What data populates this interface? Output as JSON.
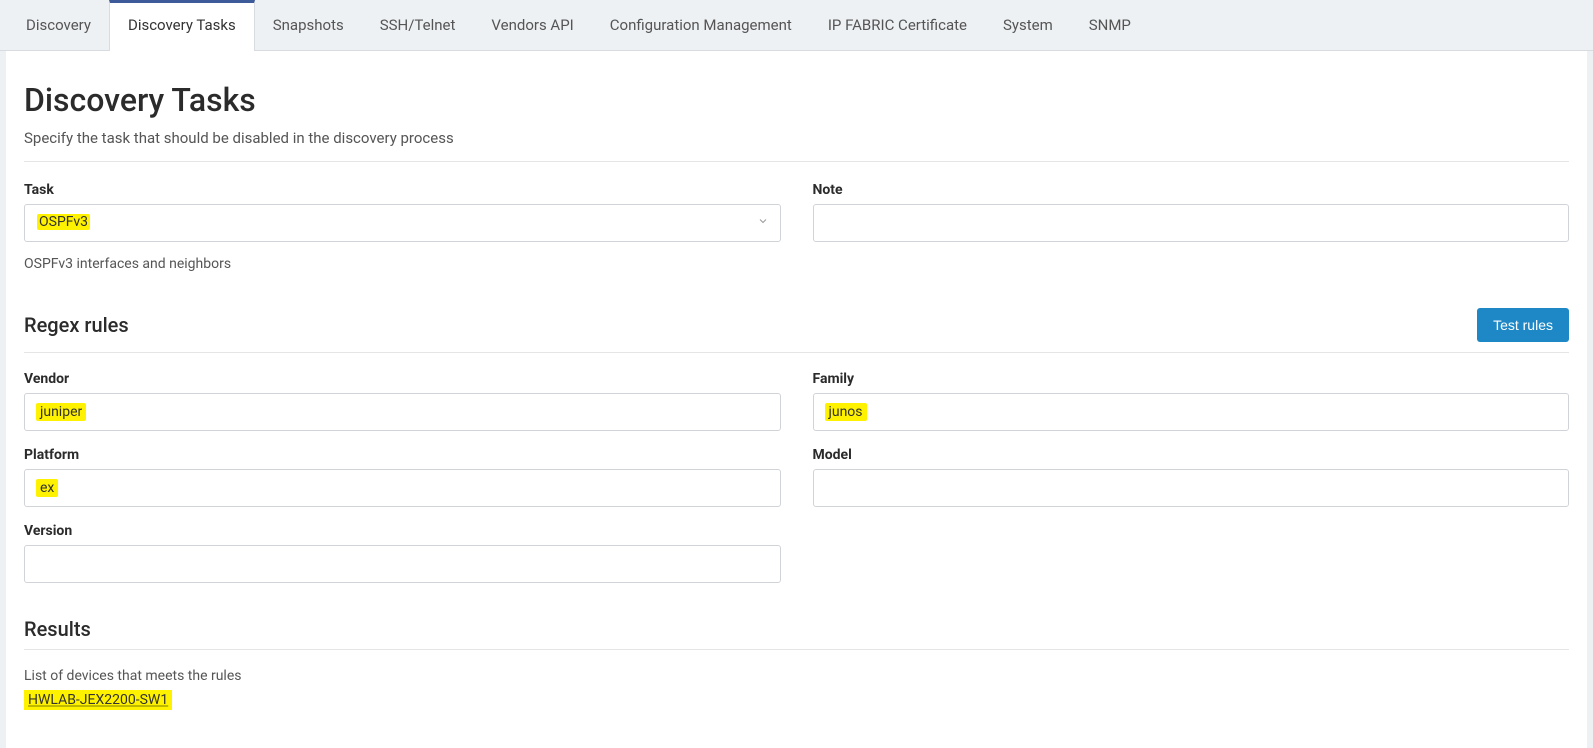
{
  "tabs": [
    {
      "label": "Discovery",
      "active": false
    },
    {
      "label": "Discovery Tasks",
      "active": true
    },
    {
      "label": "Snapshots",
      "active": false
    },
    {
      "label": "SSH/Telnet",
      "active": false
    },
    {
      "label": "Vendors API",
      "active": false
    },
    {
      "label": "Configuration Management",
      "active": false
    },
    {
      "label": "IP FABRIC Certificate",
      "active": false
    },
    {
      "label": "System",
      "active": false
    },
    {
      "label": "SNMP",
      "active": false
    }
  ],
  "page": {
    "title": "Discovery Tasks",
    "subtitle": "Specify the task that should be disabled in the discovery process"
  },
  "task_section": {
    "task_label": "Task",
    "task_value": "OSPFv3",
    "task_help": "OSPFv3 interfaces and neighbors",
    "note_label": "Note",
    "note_value": ""
  },
  "regex_section": {
    "title": "Regex rules",
    "test_button": "Test rules",
    "vendor_label": "Vendor",
    "vendor_value": "juniper",
    "family_label": "Family",
    "family_value": "junos",
    "platform_label": "Platform",
    "platform_value": "ex",
    "model_label": "Model",
    "model_value": "",
    "version_label": "Version",
    "version_value": ""
  },
  "results_section": {
    "title": "Results",
    "description": "List of devices that meets the rules",
    "devices": [
      "HWLAB-JEX2200-SW1"
    ]
  }
}
